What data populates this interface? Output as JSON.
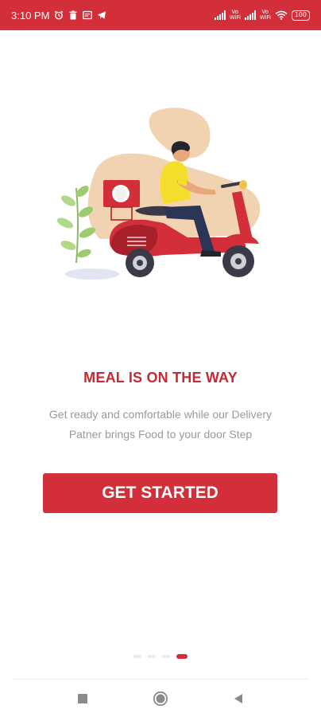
{
  "status_bar": {
    "time": "3:10 PM",
    "network_label_1": "Vo WiFi",
    "network_label_2": "Vo WiFi",
    "battery": "100",
    "icons": [
      "alarm-icon",
      "trash-icon",
      "message-icon",
      "telegram-icon",
      "signal-icon",
      "wifi-icon",
      "battery-icon"
    ]
  },
  "onboarding": {
    "title": "MEAL IS ON THE WAY",
    "description": "Get ready and comfortable while our Delivery Patner brings Food to your door Step",
    "cta_label": "GET STARTED",
    "page_count": 4,
    "active_page": 4
  },
  "colors": {
    "brand": "#d32f3a",
    "title": "#c62834",
    "description": "#9a9a9a",
    "background": "#ffffff"
  },
  "nav_bar": {
    "icons": [
      "recents-square-icon",
      "home-circle-icon",
      "back-triangle-icon"
    ]
  }
}
